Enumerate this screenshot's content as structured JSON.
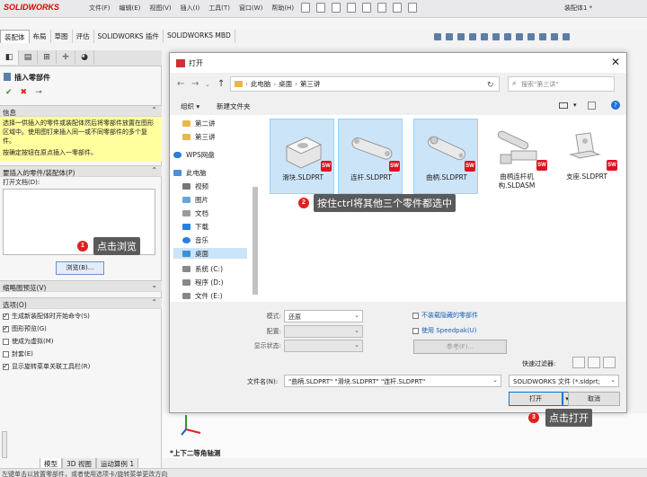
{
  "app": {
    "logo": "SOLIDWORKS",
    "menus": [
      "文件(F)",
      "编辑(E)",
      "视图(V)",
      "插入(I)",
      "工具(T)",
      "窗口(W)",
      "帮助(H)"
    ],
    "doc_title": "装配体1 *"
  },
  "ribbon": {
    "tabs": [
      "装配体",
      "布局",
      "草图",
      "评估",
      "SOLIDWORKS 插件",
      "SOLIDWORKS MBD"
    ]
  },
  "property_manager": {
    "tabs": [
      "pm-icon",
      "tree-icon",
      "config-icon",
      "origin-icon",
      "appearance-icon"
    ],
    "title": "插入零部件",
    "info_head": "信息",
    "info_text_1": "选择一供插入的零件或装配体然后将零部件放置在图形区域中。使用图钉来插入同一或不同零部件的多个复件。",
    "info_text_2": "按确定按钮在原点插入一零部件。",
    "insert_head": "要插入的零件/装配体(P)",
    "open_docs_label": "打开文档(D):",
    "browse_label": "浏览(B)...",
    "preview_head": "缩略图预览(V)",
    "options_head": "选项(O)",
    "options": [
      {
        "label": "生成新装配体时开始命令(S)",
        "checked": true
      },
      {
        "label": "图形预览(G)",
        "checked": true
      },
      {
        "label": "使成为虚拟(M)",
        "checked": false
      },
      {
        "label": "封套(E)",
        "checked": false
      },
      {
        "label": "显示旋转菜单关联工具栏(R)",
        "checked": true
      }
    ]
  },
  "callouts": {
    "c1_num": "1",
    "c1_text": "点击浏览",
    "c2_num": "2",
    "c2_text": "按住ctrl将其他三个零件都选中",
    "c3_num": "3",
    "c3_text": "点击打开"
  },
  "dialog": {
    "title": "打开",
    "breadcrumb": [
      "此电脑",
      "桌面",
      "第三讲"
    ],
    "search_placeholder": "搜索\"第三讲\"",
    "organize": "组织 ▾",
    "new_folder": "新建文件夹",
    "nav_items": [
      {
        "label": "第二讲",
        "icon": "folder-icon"
      },
      {
        "label": "第三讲",
        "icon": "folder-icon"
      },
      {
        "label": "WPS网盘",
        "icon": "cloud-icon"
      },
      {
        "label": "此电脑",
        "icon": "computer-icon"
      },
      {
        "label": "视频",
        "icon": "video-icon"
      },
      {
        "label": "图片",
        "icon": "picture-icon"
      },
      {
        "label": "文档",
        "icon": "document-icon"
      },
      {
        "label": "下载",
        "icon": "download-icon"
      },
      {
        "label": "音乐",
        "icon": "music-icon"
      },
      {
        "label": "桌面",
        "icon": "desktop-icon"
      },
      {
        "label": "系统 (C:)",
        "icon": "drive-icon"
      },
      {
        "label": "程序 (D:)",
        "icon": "drive-icon"
      },
      {
        "label": "文件 (E:)",
        "icon": "drive-icon"
      }
    ],
    "files": [
      {
        "name": "滑块.SLDPRT",
        "selected": true
      },
      {
        "name": "连杆.SLDPRT",
        "selected": true
      },
      {
        "name": "曲柄.SLDPRT",
        "selected": true
      },
      {
        "name": "曲柄连杆机构.SLDASM",
        "selected": false
      },
      {
        "name": "支座.SLDPRT",
        "selected": false
      }
    ],
    "mode_label": "模式:",
    "mode_value": "还原",
    "config_label": "配置:",
    "display_state_label": "显示状态:",
    "hidden_components": "不装载隐藏的零部件",
    "speedpak": "使用 Speedpak(U)",
    "reference": "参考(F)...",
    "quick_filter": "快速过滤器:",
    "filename_label": "文件名(N):",
    "filename_value": "\"曲柄.SLDPRT\" \"滑块.SLDPRT\" \"连杆.SLDPRT\"",
    "filetype_value": "SOLIDWORKS 文件 (*.sldprt;",
    "open_btn": "打开",
    "cancel_btn": "取消"
  },
  "graphics": {
    "view_label": "*上下二等角轴测"
  },
  "bottom_tabs": [
    "模型",
    "3D 视图",
    "运动算例 1"
  ],
  "status": "左键单击以放置零部件，或者使用选项卡/旋转菜单更改方向"
}
